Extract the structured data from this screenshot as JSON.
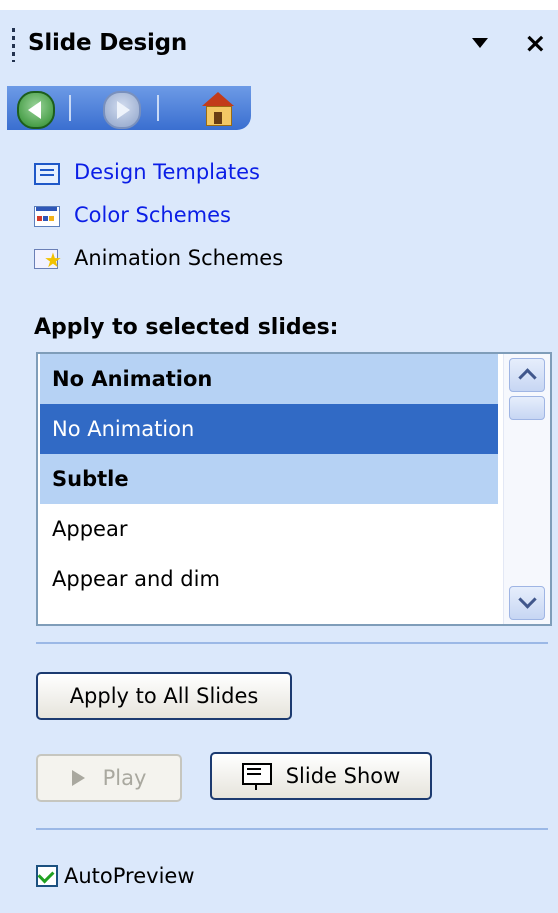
{
  "pane": {
    "title": "Slide Design",
    "dropdown_icon": "triangle-down-icon",
    "close_label": "×"
  },
  "nav": {
    "back_icon": "back-arrow-icon",
    "forward_icon": "forward-arrow-icon",
    "home_icon": "home-icon"
  },
  "links": [
    {
      "label": "Design Templates",
      "icon": "design-templates-icon",
      "color": "#0b1ee6"
    },
    {
      "label": "Color Schemes",
      "icon": "color-schemes-icon",
      "color": "#0b1ee6"
    },
    {
      "label": "Animation Schemes",
      "icon": "animation-schemes-icon",
      "color": "#000000"
    }
  ],
  "apply_section": {
    "label": "Apply to selected slides:"
  },
  "scheme_list": {
    "rows": [
      {
        "text": "No Animation",
        "kind": "group"
      },
      {
        "text": "No Animation",
        "kind": "selected"
      },
      {
        "text": "Subtle",
        "kind": "group"
      },
      {
        "text": "Appear",
        "kind": "item"
      },
      {
        "text": "Appear and dim",
        "kind": "item"
      }
    ]
  },
  "buttons": {
    "apply_all": "Apply to All Slides",
    "play": "Play",
    "slide_show": "Slide Show"
  },
  "autopreview": {
    "label": "AutoPreview",
    "checked": true
  },
  "colors": {
    "pane_bg": "#dbe8fb",
    "selection": "#316ac5",
    "group_header": "#b6d2f4",
    "link": "#0b1ee6"
  }
}
